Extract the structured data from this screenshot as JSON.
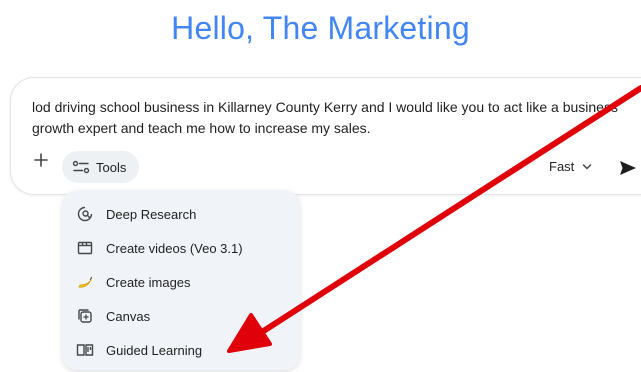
{
  "greeting": "Hello, The Marketing",
  "prompt": {
    "text": "lod driving school business in Killarney County Kerry and I would like you to act like a business growth expert and teach me how to increase my sales."
  },
  "toolbar": {
    "plus_icon": "plus-icon",
    "tools_label": "Tools",
    "model_label": "Fast",
    "send_icon": "send-icon"
  },
  "tools_menu": {
    "items": [
      {
        "label": "Deep Research",
        "icon": "deep-research-icon"
      },
      {
        "label": "Create videos (Veo 3.1)",
        "icon": "video-icon"
      },
      {
        "label": "Create images",
        "icon": "banana-icon"
      },
      {
        "label": "Canvas",
        "icon": "canvas-icon"
      },
      {
        "label": "Guided Learning",
        "icon": "guided-learning-icon"
      }
    ]
  },
  "colors": {
    "greeting": "#4285f4",
    "menu_bg": "#f0f4f9",
    "arrow": "#e0000a"
  }
}
